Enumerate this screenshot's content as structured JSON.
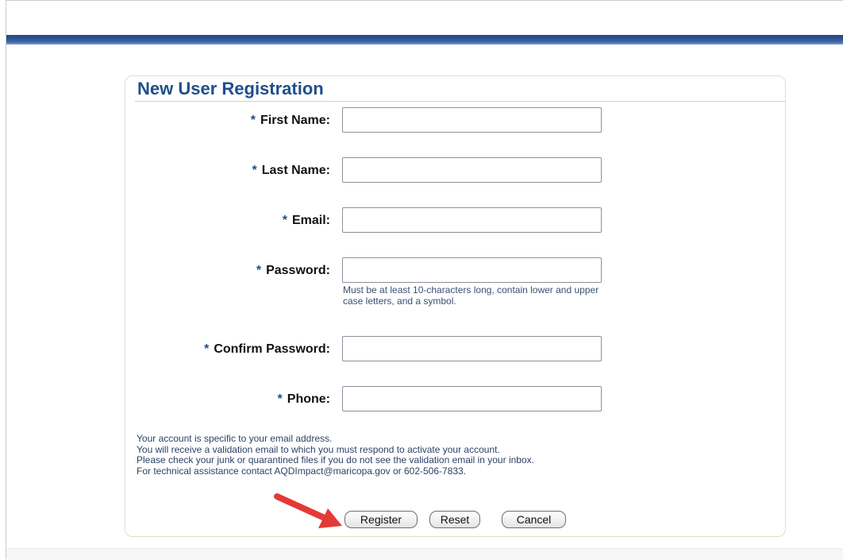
{
  "form": {
    "title": "New User Registration",
    "required_marker": "*",
    "fields": [
      {
        "label": "First Name:",
        "value": ""
      },
      {
        "label": "Last Name:",
        "value": ""
      },
      {
        "label": "Email:",
        "value": ""
      },
      {
        "label": "Password:",
        "value": ""
      },
      {
        "label": "Confirm Password:",
        "value": ""
      },
      {
        "label": "Phone:",
        "value": ""
      }
    ],
    "password_hint": "Must be at least 10-characters long, contain lower and upper case letters, and a symbol.",
    "notes": [
      "Your account is specific to your email address.",
      "You will receive a validation email to which you must respond to activate your account.",
      "Please check your junk or quarantined files if you do not see the validation email in your inbox.",
      "For technical assistance contact AQDImpact@maricopa.gov or 602-506-7833."
    ],
    "buttons": {
      "register": "Register",
      "reset": "Reset",
      "cancel": "Cancel"
    }
  },
  "colors": {
    "header_bar": "#2d5695",
    "title": "#1f4e8c",
    "annotation_arrow": "#e53935"
  },
  "icons": {
    "annotation": "arrow-pointer-icon"
  }
}
